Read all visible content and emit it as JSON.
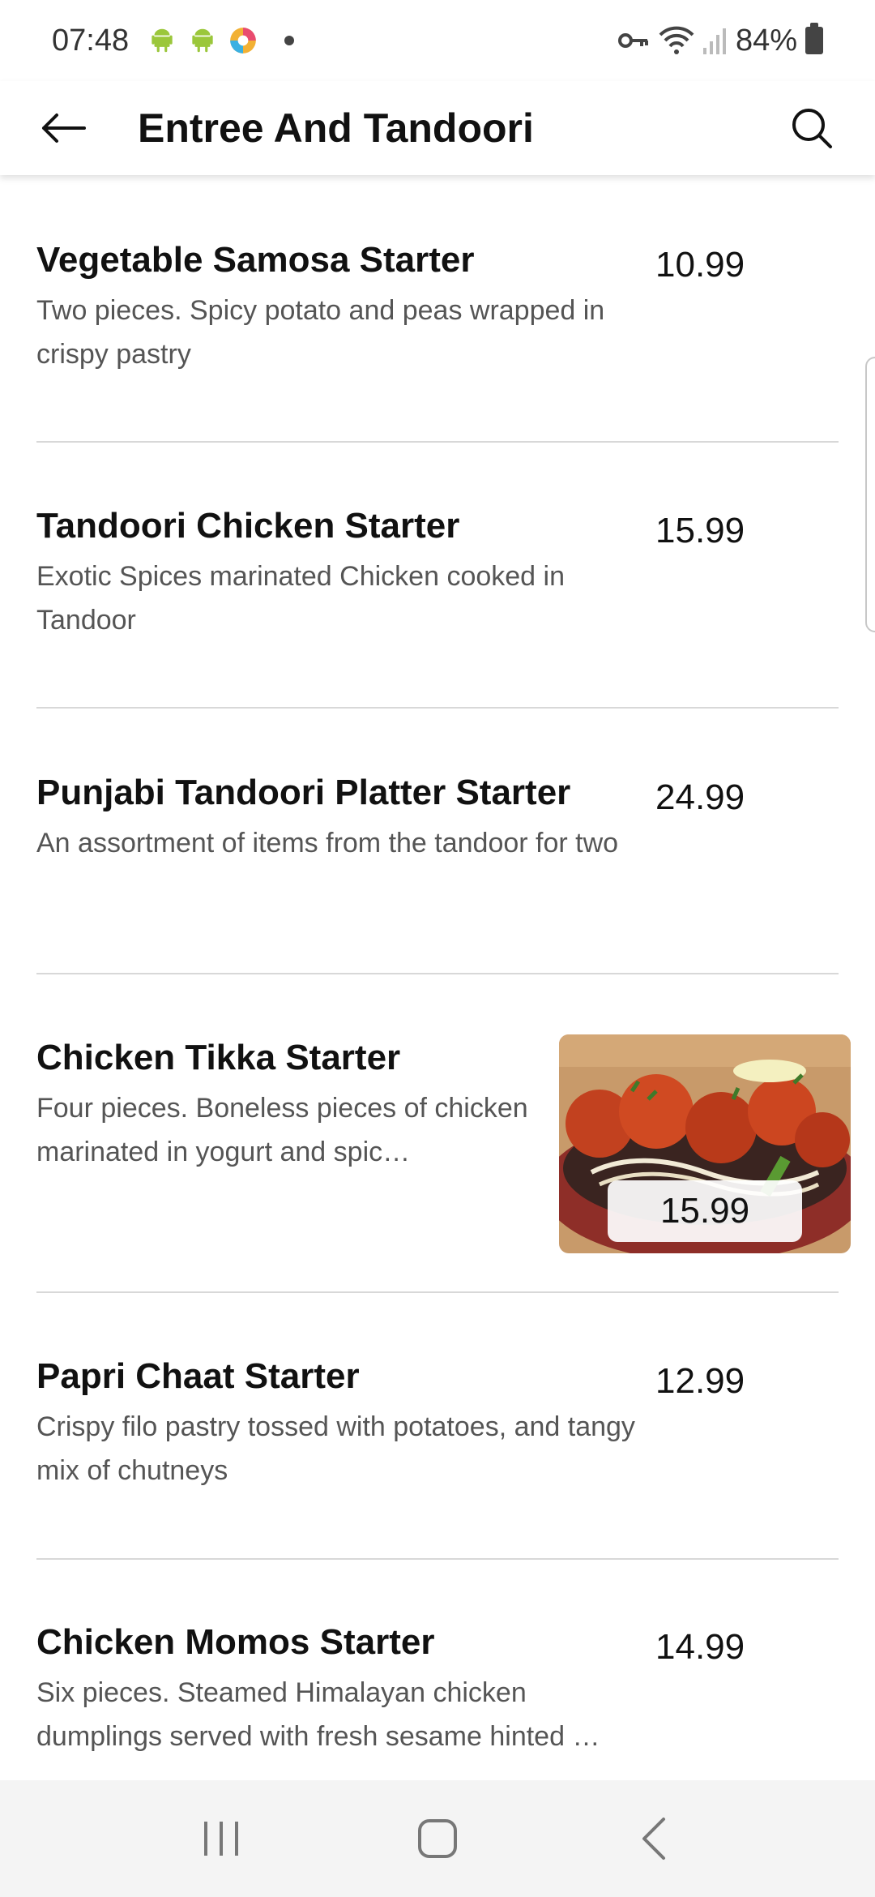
{
  "status_bar": {
    "time": "07:48",
    "battery": "84%",
    "icons": [
      "android-icon",
      "android-icon",
      "app-icon",
      "vpn-key-icon",
      "wifi-icon",
      "signal-icon",
      "battery-icon"
    ]
  },
  "header": {
    "title": "Entree And Tandoori"
  },
  "menu": {
    "items": [
      {
        "name": "Vegetable Samosa Starter",
        "description": "Two pieces. Spicy potato and peas wrapped in crispy pastry",
        "price": "10.99"
      },
      {
        "name": "Tandoori Chicken Starter",
        "description": "Exotic Spices marinated Chicken cooked in Tandoor",
        "price": "15.99"
      },
      {
        "name": "Punjabi Tandoori Platter Starter",
        "description": "An assortment of items from the tandoor for two",
        "price": "24.99"
      },
      {
        "name": "Chicken Tikka Starter",
        "description": "Four pieces. Boneless pieces of chicken marinated in yogurt and spic…",
        "price": "15.99",
        "has_image": true
      },
      {
        "name": "Papri Chaat Starter",
        "description": "Crispy filo pastry tossed with potatoes, and tangy mix of chutneys",
        "price": "12.99"
      },
      {
        "name": "Chicken Momos Starter",
        "description": "Six pieces. Steamed Himalayan chicken dumplings served with fresh sesame hinted …",
        "price": "14.99"
      }
    ]
  },
  "nav_bar": {
    "buttons": [
      "recents-icon",
      "home-icon",
      "back-nav-icon"
    ]
  },
  "colors": {
    "text_primary": "#111111",
    "text_secondary": "#555555",
    "divider": "#d8d8d8",
    "nav_bg": "#f4f4f4",
    "android_green": "#9bc73b"
  }
}
